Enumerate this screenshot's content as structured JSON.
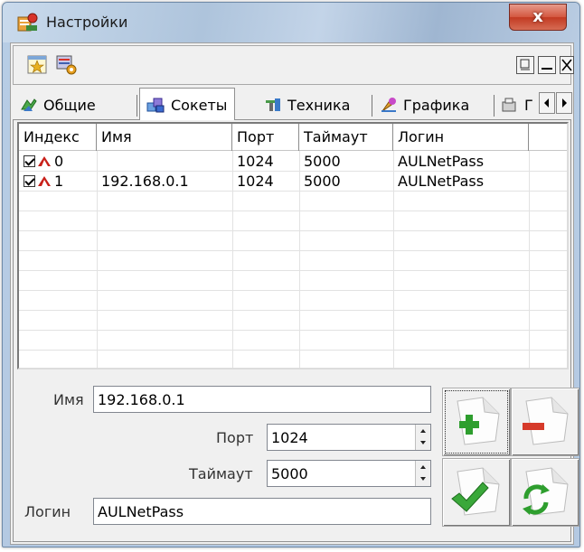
{
  "window": {
    "title": "Настройки",
    "close_label": "x"
  },
  "toolbar": {
    "icons": [
      "star-icon",
      "settings-icon"
    ],
    "mdi_icons": [
      "tile-icon",
      "minimize-icon",
      "close-icon"
    ]
  },
  "tabs": [
    {
      "label": "Общие",
      "icon": "general-icon",
      "active": false
    },
    {
      "label": "Сокеты",
      "icon": "sockets-icon",
      "active": true
    },
    {
      "label": "Техника",
      "icon": "machinery-icon",
      "active": false
    },
    {
      "label": "Графика",
      "icon": "graphics-icon",
      "active": false
    },
    {
      "label": "Г",
      "icon": "more-icon",
      "active": false
    }
  ],
  "grid": {
    "columns": [
      "Индекс",
      "Имя",
      "Порт",
      "Таймаут",
      "Логин"
    ],
    "rows": [
      {
        "index": "0",
        "name": "",
        "port": "1024",
        "timeout": "5000",
        "login": "AULNetPass",
        "checked": true
      },
      {
        "index": "1",
        "name": "192.168.0.1",
        "port": "1024",
        "timeout": "5000",
        "login": "AULNetPass",
        "checked": true
      }
    ]
  },
  "form": {
    "name_label": "Имя",
    "name_value": "192.168.0.1",
    "port_label": "Порт",
    "port_value": "1024",
    "timeout_label": "Таймаут",
    "timeout_value": "5000",
    "login_label": "Логин",
    "login_value": "AULNetPass"
  },
  "actions": [
    "add-button",
    "delete-button",
    "apply-button",
    "refresh-button"
  ],
  "colors": {
    "close_red": "#c23a22",
    "add_green": "#2e9e2e",
    "delete_red": "#d63a2a",
    "socket_red": "#c8201a"
  }
}
